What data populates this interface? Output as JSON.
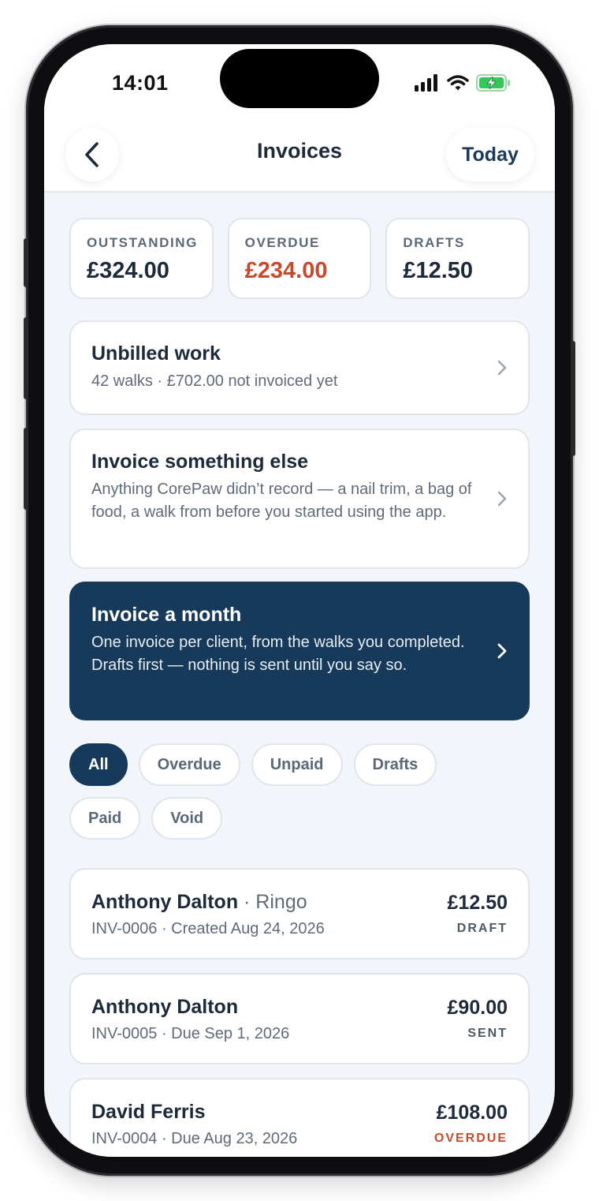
{
  "status_bar": {
    "time": "14:01"
  },
  "nav": {
    "title": "Invoices",
    "today_label": "Today"
  },
  "summary": [
    {
      "label": "OUTSTANDING",
      "value": "£324.00"
    },
    {
      "label": "OVERDUE",
      "value": "£234.00"
    },
    {
      "label": "DRAFTS",
      "value": "£12.50"
    }
  ],
  "cards": {
    "unbilled": {
      "title": "Unbilled work",
      "subtitle": "42 walks · £702.00 not invoiced yet"
    },
    "something_else": {
      "title": "Invoice something else",
      "subtitle": "Anything CorePaw didn’t record — a nail trim, a bag of food, a walk from before you started using the app."
    },
    "month": {
      "title": "Invoice a month",
      "subtitle": "One invoice per client, from the walks you completed. Drafts first — nothing is sent until you say so."
    }
  },
  "filters": [
    "All",
    "Overdue",
    "Unpaid",
    "Drafts",
    "Paid",
    "Void"
  ],
  "invoices": [
    {
      "client": "Anthony Dalton",
      "pet": " · Ringo",
      "meta": "INV-0006 · Created Aug 24, 2026",
      "amount": "£12.50",
      "status": "DRAFT"
    },
    {
      "client": "Anthony Dalton",
      "pet": "",
      "meta": "INV-0005 · Due Sep 1, 2026",
      "amount": "£90.00",
      "status": "SENT"
    },
    {
      "client": "David Ferris",
      "pet": "",
      "meta": "INV-0004 · Due Aug 23, 2026",
      "amount": "£108.00",
      "status": "OVERDUE"
    }
  ],
  "colors": {
    "primary": "#173a5a",
    "overdue": "#c84a2b",
    "battery": "#34c759"
  }
}
